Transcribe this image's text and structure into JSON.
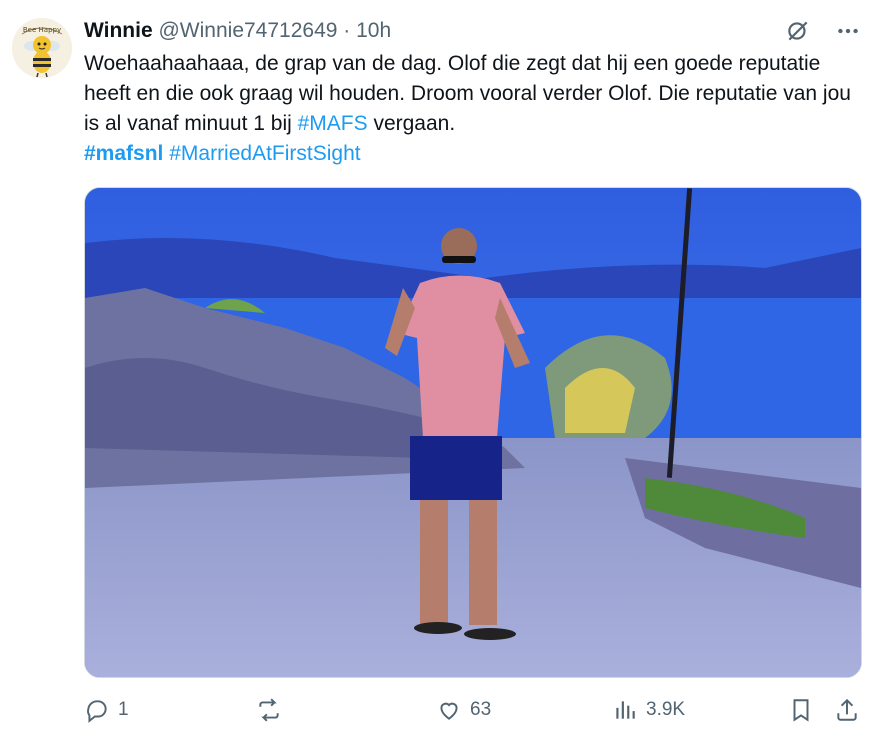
{
  "author": {
    "display_name": "Winnie",
    "handle": "@Winnie74712649",
    "separator": "·",
    "time": "10h",
    "avatar_badge": "Bee Happy"
  },
  "tweet": {
    "text_1": "Woehaahaahaaa, de grap van de dag. Olof die zegt dat hij een goede reputatie heeft en die ook graag wil houden. Droom vooral verder Olof. Die reputatie van jou is al vanaf minuut 1 bij ",
    "inline_tag": "#MAFS",
    "text_2": " vergaan.",
    "hashtag_1": "#mafsnl",
    "hashtag_2": "#MarriedAtFirstSight"
  },
  "actions": {
    "reply_count": "1",
    "retweet_count": "",
    "like_count": "63",
    "view_count": "3.9K"
  },
  "icons": {
    "grok": "grok-icon",
    "more": "more-icon",
    "reply": "reply-icon",
    "retweet": "retweet-icon",
    "like": "heart-icon",
    "views": "views-icon",
    "bookmark": "bookmark-icon",
    "share": "share-icon"
  },
  "colors": {
    "link": "#1d9bf0",
    "muted": "#536471",
    "text": "#0f1419"
  }
}
